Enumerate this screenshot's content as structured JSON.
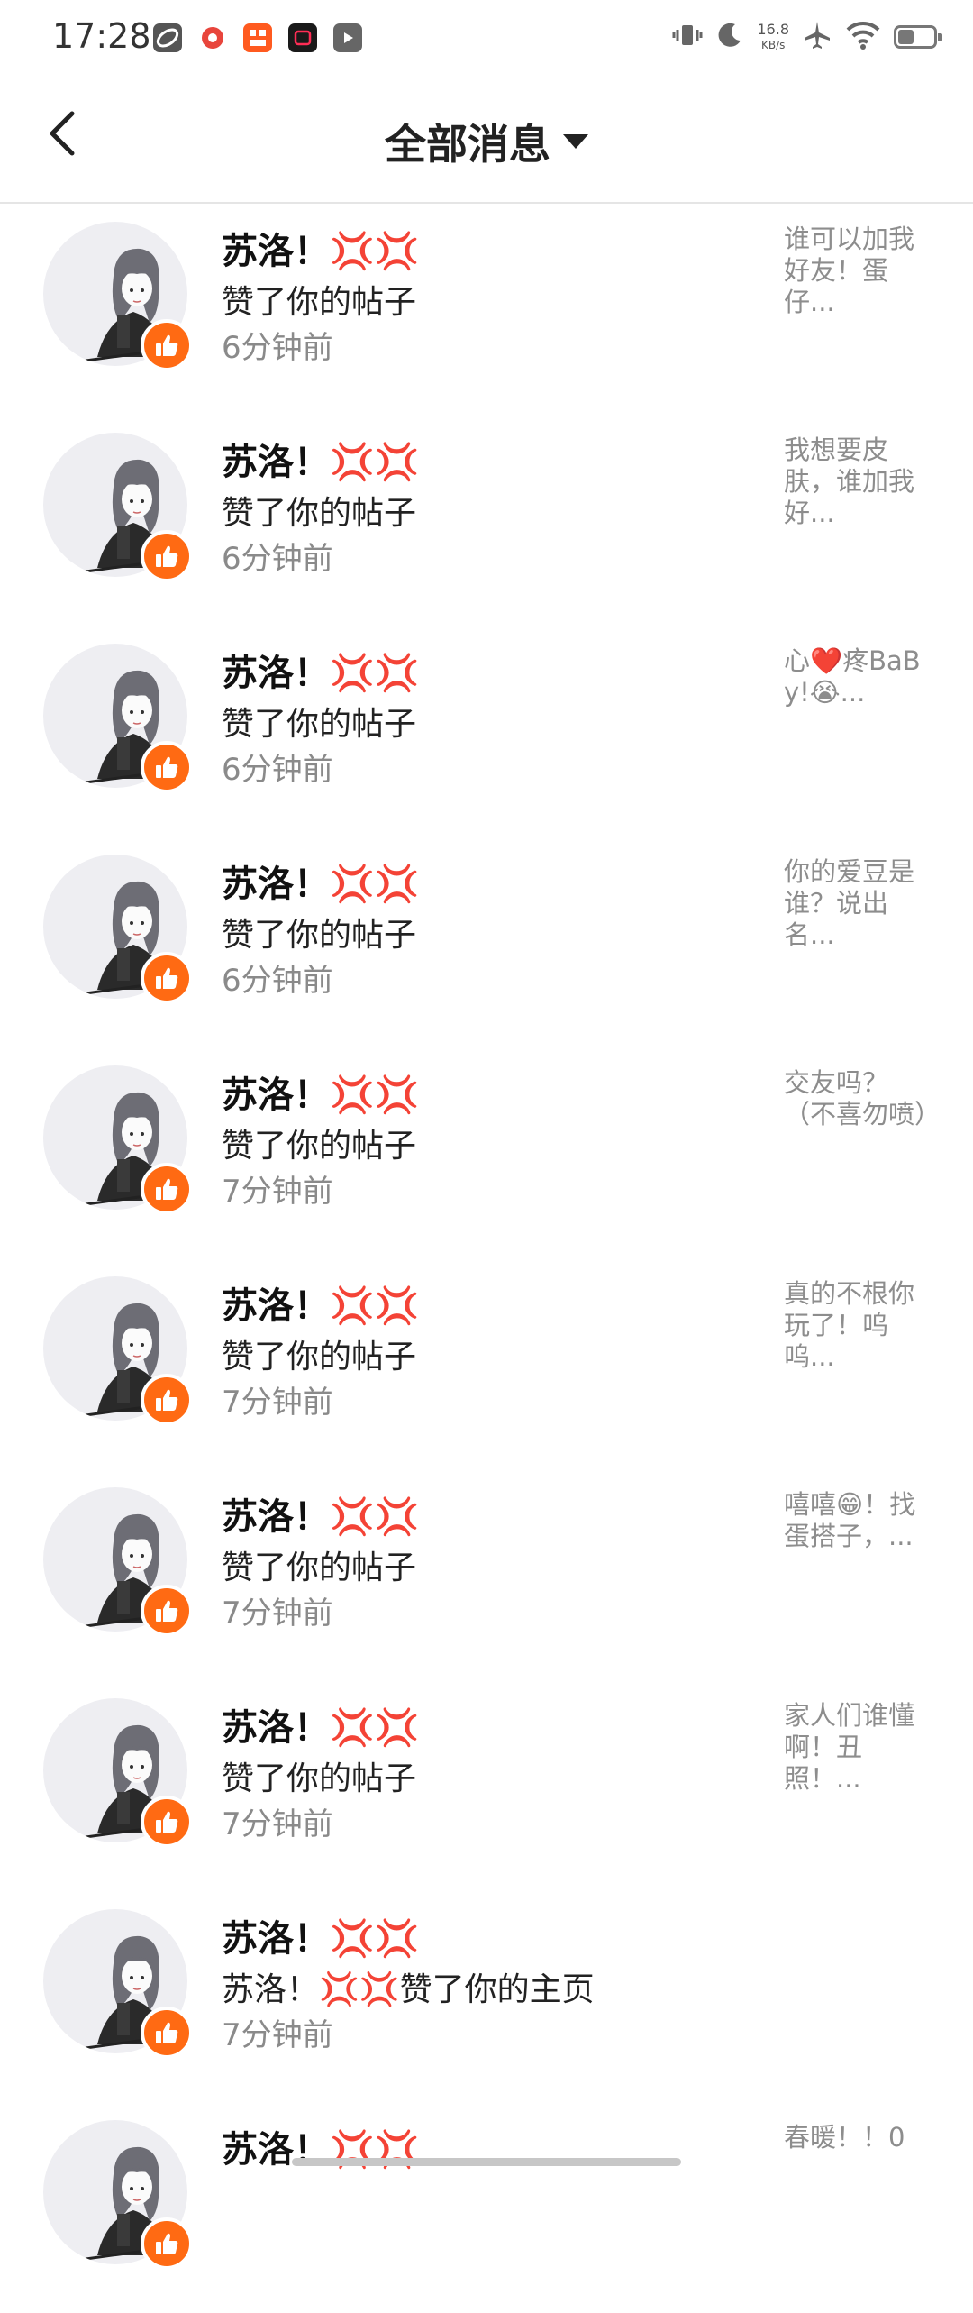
{
  "status_bar": {
    "time": "17:28",
    "net_speed": "16.8",
    "net_unit": "KB/s",
    "battery_level": 0.45
  },
  "header": {
    "title": "全部消息"
  },
  "messages": [
    {
      "name": "苏洛！💢💢",
      "action": "赞了你的帖子",
      "time": "6分钟前",
      "preview": "谁可以加我好友！蛋仔..."
    },
    {
      "name": "苏洛！💢💢",
      "action": "赞了你的帖子",
      "time": "6分钟前",
      "preview": "我想要皮肤，谁加我好..."
    },
    {
      "name": "苏洛！💢💢",
      "action": "赞了你的帖子",
      "time": "6分钟前",
      "preview": "心❤️疼BaBy!😭..."
    },
    {
      "name": "苏洛！💢💢",
      "action": "赞了你的帖子",
      "time": "6分钟前",
      "preview": "你的爱豆是谁？说出名..."
    },
    {
      "name": "苏洛！💢💢",
      "action": "赞了你的帖子",
      "time": "7分钟前",
      "preview": "交友吗？（不喜勿喷）"
    },
    {
      "name": "苏洛！💢💢",
      "action": "赞了你的帖子",
      "time": "7分钟前",
      "preview": "真的不根你玩了！呜呜..."
    },
    {
      "name": "苏洛！💢💢",
      "action": "赞了你的帖子",
      "time": "7分钟前",
      "preview": "嘻嘻😁！找蛋搭子，..."
    },
    {
      "name": "苏洛！💢💢",
      "action": "赞了你的帖子",
      "time": "7分钟前",
      "preview": "家人们谁懂啊！丑照！..."
    },
    {
      "name": "苏洛！💢💢",
      "action": "苏洛！💢💢赞了你的主页",
      "time": "7分钟前",
      "preview": ""
    },
    {
      "name": "苏洛！💢💢",
      "action": "",
      "time": "",
      "preview": "春暖！！0"
    }
  ],
  "colors": {
    "accent": "#ff6a13",
    "badge_bg": "#ff6a13"
  }
}
